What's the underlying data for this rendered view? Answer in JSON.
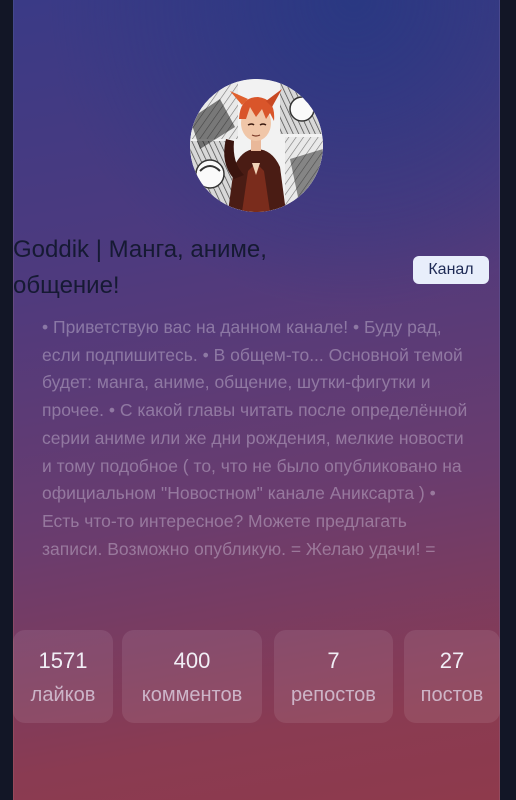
{
  "channel": {
    "title_line1": "Goddik | Манга, аниме,",
    "title_line2": "общение!",
    "badge": "Канал",
    "description": "• Приветствую вас на данном канале! • Буду рад, если подпишитесь. • В общем-то... Основной темой будет: манга, аниме, общение, шутки-фигутки и прочее. • С какой главы читать после определённой серии аниме или же дни рождения, мелкие новости и тому подобное ( то, что не было опубликовано на официальном \"Новостном\" канале Аниксарта ) • Есть что-то интересное? Можете предлагать записи. Возможно опубликую. = Желаю удачи! ="
  },
  "stats": [
    {
      "value": "1571",
      "label": "лайков"
    },
    {
      "value": "400",
      "label": "комментов"
    },
    {
      "value": "7",
      "label": "репостов"
    },
    {
      "value": "27",
      "label": "постов"
    }
  ],
  "colors": {
    "title": "#161a33",
    "badge_bg": "#e8eefb",
    "badge_text": "#1e2a55",
    "gradient_top": "#3a3a86",
    "gradient_bottom": "#8e3a4c"
  },
  "icons": {
    "avatar": "manga-character-avatar"
  }
}
